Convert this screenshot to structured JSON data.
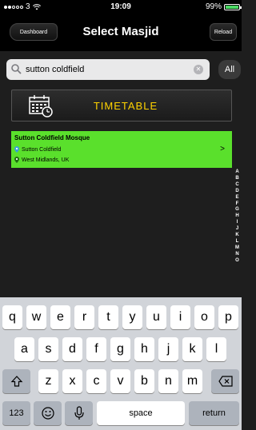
{
  "status": {
    "carrier": "3",
    "time": "19:09",
    "battery": "99%"
  },
  "nav": {
    "back_label": "Dashboard",
    "title": "Select Masjid",
    "reload_label": "Reload"
  },
  "search": {
    "value": "sutton coldfield",
    "all_label": "All"
  },
  "timetable": {
    "label": "TIMETABLE"
  },
  "result": {
    "name": "Sutton Coldfield Mosque",
    "town": "Sutton Coldfield",
    "region": "West Midlands, UK",
    "chevron": ">"
  },
  "index_letters": [
    "A",
    "B",
    "C",
    "D",
    "E",
    "F",
    "G",
    "H",
    "I",
    "J",
    "K",
    "L",
    "M",
    "N",
    "O"
  ],
  "keyboard": {
    "row1": [
      "q",
      "w",
      "e",
      "r",
      "t",
      "y",
      "u",
      "i",
      "o",
      "p"
    ],
    "row2": [
      "a",
      "s",
      "d",
      "f",
      "g",
      "h",
      "j",
      "k",
      "l"
    ],
    "row3": [
      "z",
      "x",
      "c",
      "v",
      "b",
      "n",
      "m"
    ],
    "numbers": "123",
    "space": "space",
    "return": "return"
  },
  "colors": {
    "result_bg": "#5ae02c",
    "timetable_text": "#ffd200",
    "battery": "#4cd964"
  }
}
